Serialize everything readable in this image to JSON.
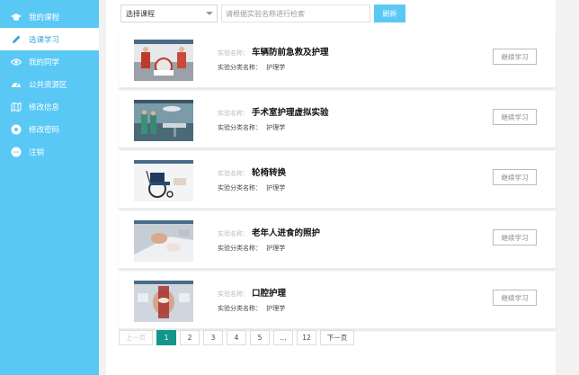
{
  "sidebar": {
    "items": [
      {
        "label": "我的课程",
        "icon": "graduation-cap-icon",
        "active": false
      },
      {
        "label": "选课学习",
        "icon": "pencil-icon",
        "active": true
      },
      {
        "label": "我的同学",
        "icon": "eye-icon",
        "active": false
      },
      {
        "label": "公共资源区",
        "icon": "dashboard-icon",
        "active": false
      },
      {
        "label": "修改信息",
        "icon": "map-icon",
        "active": false
      },
      {
        "label": "修改密码",
        "icon": "gear-circle-icon",
        "active": false
      },
      {
        "label": "注销",
        "icon": "chat-icon",
        "active": false
      }
    ]
  },
  "toolbar": {
    "select_value": "选择课程",
    "search_placeholder": "请根据实验名称进行检索",
    "search_button": "刷新"
  },
  "labels": {
    "name_label": "实验名称：",
    "category_label": "实验分类名称：",
    "continue": "继续学习"
  },
  "experiments": [
    {
      "title": "车辆防前急救及护理",
      "category": "护理学",
      "thumbnail": "first-aid-scene"
    },
    {
      "title": "手术室护理虚拟实验",
      "category": "护理学",
      "thumbnail": "operating-room-scene"
    },
    {
      "title": "轮椅转换",
      "category": "护理学",
      "thumbnail": "wheelchair-scene"
    },
    {
      "title": "老年人进食的照护",
      "category": "护理学",
      "thumbnail": "elderly-feeding-scene"
    },
    {
      "title": "口腔护理",
      "category": "护理学",
      "thumbnail": "oral-care-scene"
    }
  ],
  "pagination": {
    "prev": "上一页",
    "pages": [
      "1",
      "2",
      "3",
      "4",
      "5",
      "...",
      "12"
    ],
    "current": "1",
    "next": "下一页"
  }
}
